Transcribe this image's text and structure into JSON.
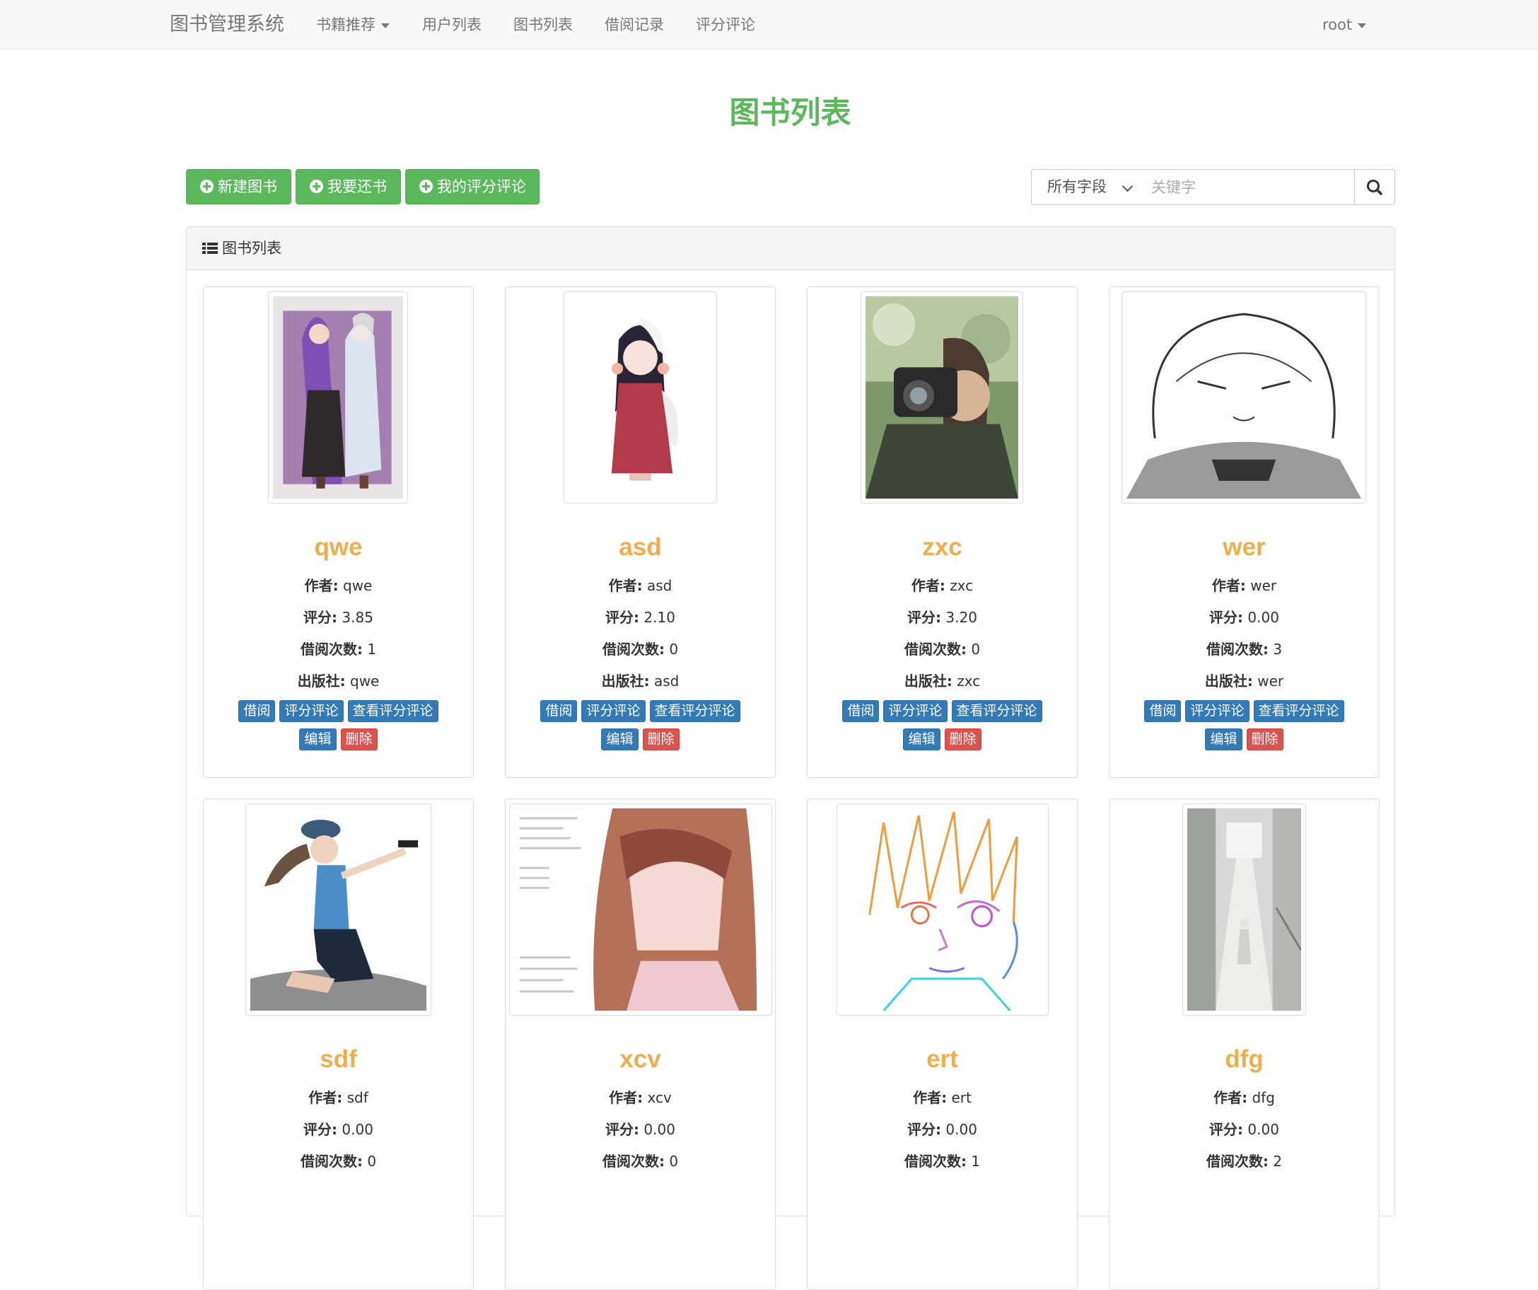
{
  "navbar": {
    "brand": "图书管理系统",
    "items": [
      "书籍推荐",
      "用户列表",
      "图书列表",
      "借阅记录",
      "评分评论"
    ],
    "user": "root"
  },
  "page_title": "图书列表",
  "actions": {
    "new_book": "新建图书",
    "return_book": "我要还书",
    "my_reviews": "我的评分评论"
  },
  "search": {
    "field_select": "所有字段",
    "placeholder": "关键字"
  },
  "panel": {
    "heading": "图书列表"
  },
  "labels": {
    "author": "作者:",
    "rating": "评分:",
    "borrow_count": "借阅次数:",
    "publisher": "出版社:"
  },
  "card_buttons": {
    "borrow": "借阅",
    "review": "评分评论",
    "view_reviews": "查看评分评论",
    "edit": "编辑",
    "delete": "删除"
  },
  "books": [
    {
      "title": "qwe",
      "author": "qwe",
      "rating": "3.85",
      "borrow_count": "1",
      "publisher": "qwe"
    },
    {
      "title": "asd",
      "author": "asd",
      "rating": "2.10",
      "borrow_count": "0",
      "publisher": "asd"
    },
    {
      "title": "zxc",
      "author": "zxc",
      "rating": "3.20",
      "borrow_count": "0",
      "publisher": "zxc"
    },
    {
      "title": "wer",
      "author": "wer",
      "rating": "0.00",
      "borrow_count": "3",
      "publisher": "wer"
    },
    {
      "title": "sdf",
      "author": "sdf",
      "rating": "0.00",
      "borrow_count": "0"
    },
    {
      "title": "xcv",
      "author": "xcv",
      "rating": "0.00",
      "borrow_count": "0"
    },
    {
      "title": "ert",
      "author": "ert",
      "rating": "0.00",
      "borrow_count": "1"
    },
    {
      "title": "dfg",
      "author": "dfg",
      "rating": "0.00",
      "borrow_count": "2"
    }
  ],
  "colors": {
    "primary_green": "#5cb85c",
    "title_orange": "#f0ad4e",
    "button_blue": "#337ab7",
    "button_red": "#d9534f"
  }
}
